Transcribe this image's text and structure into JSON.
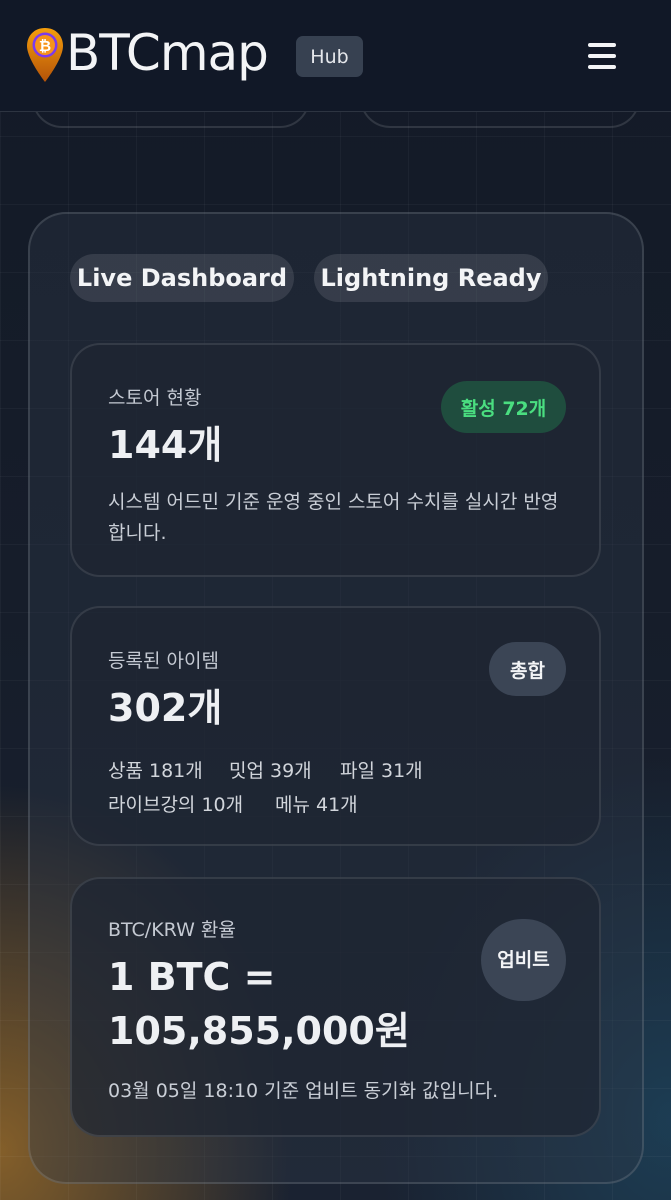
{
  "header": {
    "logo_text": "BTCmap",
    "hub_label": "Hub",
    "logo_icon": "bitcoin-map-pin-icon",
    "menu_icon": "hamburger-menu-icon"
  },
  "pills": [
    "Live Dashboard",
    "Lightning Ready"
  ],
  "store_card": {
    "label": "스토어 현황",
    "value": "144개",
    "badge": "활성 72개",
    "description": "시스템 어드민 기준 운영 중인 스토어 수치를 실시간 반영합니다."
  },
  "items_card": {
    "label": "등록된 아이템",
    "value": "302개",
    "badge": "총합",
    "stats": [
      "상품 181개",
      "밋업 39개",
      "파일 31개",
      "라이브강의 10개",
      "메뉴 41개"
    ]
  },
  "rate_card": {
    "label": "BTC/KRW 환율",
    "value_line1": "1 BTC =",
    "value_line2": "105,855,000원",
    "badge": "업비트",
    "description": "03월 05일 18:10 기준 업비트 동기화 값입니다."
  },
  "colors": {
    "header_bg": "#111827",
    "active_badge_bg": "#1f4d3e",
    "active_badge_text": "#4ade80",
    "bitcoin_orange": "#f7931a"
  }
}
